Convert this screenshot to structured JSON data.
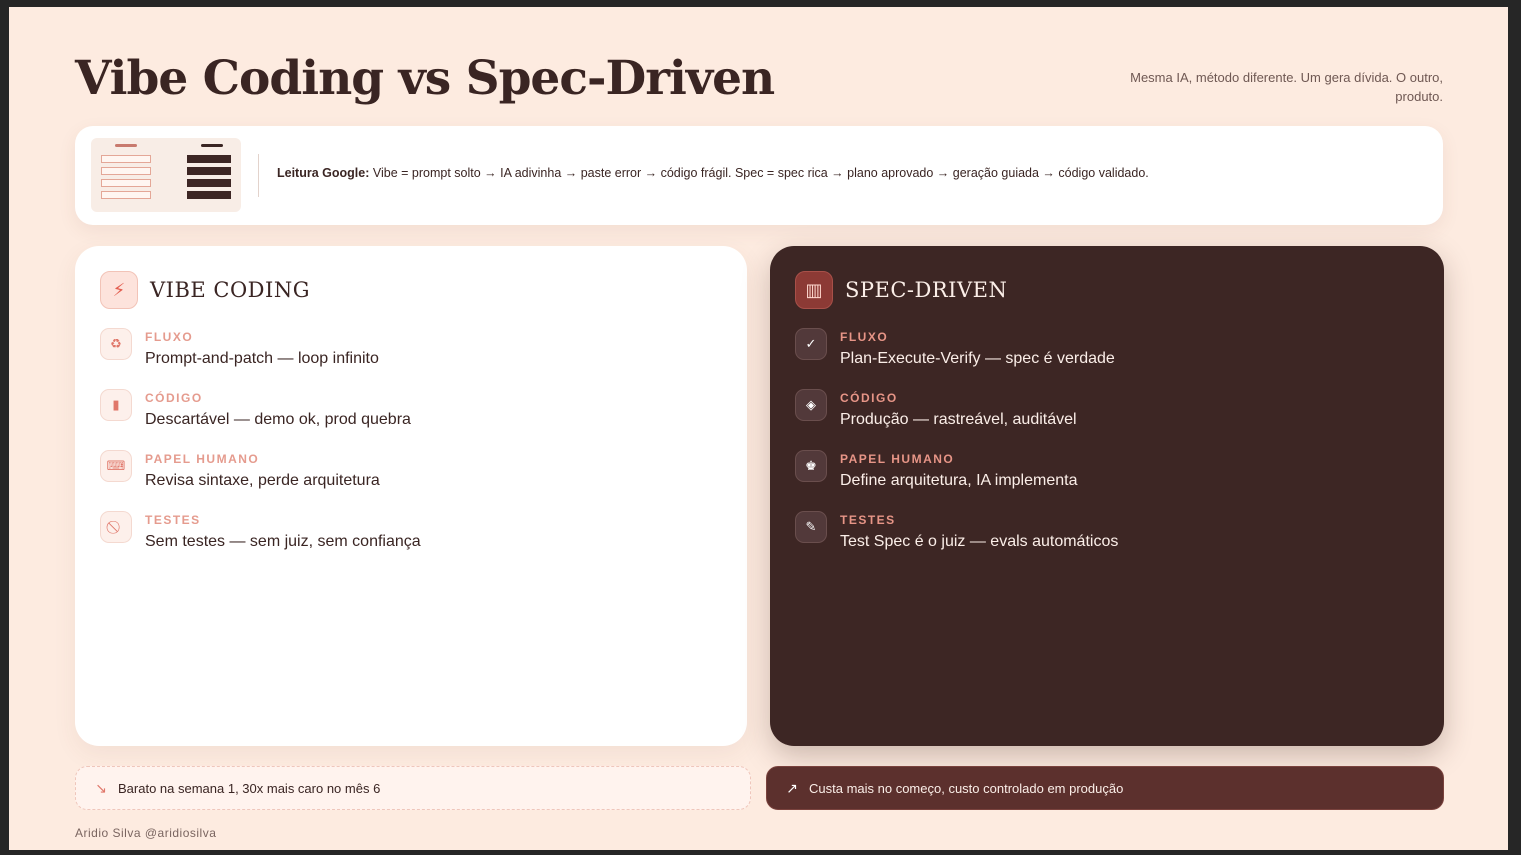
{
  "header": {
    "title": "Vibe Coding vs Spec-Driven",
    "subtitle": "Mesma IA, método diferente. Um gera dívida. O outro, produto."
  },
  "google_reading": {
    "label": "Leitura Google:",
    "text": " Vibe = prompt solto → IA adivinha → paste error → código frágil. Spec = spec rica → plano aprovado → geração guiada → código validado."
  },
  "vibe": {
    "title": "VIBE CODING",
    "icon": "lightning-icon",
    "items": [
      {
        "label": "FLUXO",
        "value": "Prompt-and-patch — loop infinito",
        "icon": "recycle-icon"
      },
      {
        "label": "CÓDIGO",
        "value": "Descartável — demo ok, prod quebra",
        "icon": "disposable-cup-icon"
      },
      {
        "label": "PAPEL HUMANO",
        "value": "Revisa sintaxe, perde arquitetura",
        "icon": "keyboard-icon"
      },
      {
        "label": "TESTES",
        "value": "Sem testes — sem juiz, sem confiança",
        "icon": "prohibited-icon"
      }
    ],
    "footer": "Barato na semana 1, 30x mais caro no mês 6",
    "footer_icon": "trend-down-icon"
  },
  "spec": {
    "title": "SPEC-DRIVEN",
    "icon": "map-icon",
    "items": [
      {
        "label": "FLUXO",
        "value": "Plan-Execute-Verify — spec é verdade",
        "icon": "check-icon"
      },
      {
        "label": "CÓDIGO",
        "value": "Produção — rastreável, auditável",
        "icon": "box-icon"
      },
      {
        "label": "PAPEL HUMANO",
        "value": "Define arquitetura, IA implementa",
        "icon": "chess-king-icon"
      },
      {
        "label": "TESTES",
        "value": "Test Spec é o juiz — evals automáticos",
        "icon": "gavel-icon"
      }
    ],
    "footer": "Custa mais no começo, custo controlado em produção",
    "footer_icon": "trend-up-icon"
  },
  "author": "Aridio Silva @aridiosilva",
  "colors": {
    "background": "#fdebe0",
    "dark_card": "#3d2624",
    "accent": "#e35d4f",
    "label_pink": "#e59b8e"
  }
}
